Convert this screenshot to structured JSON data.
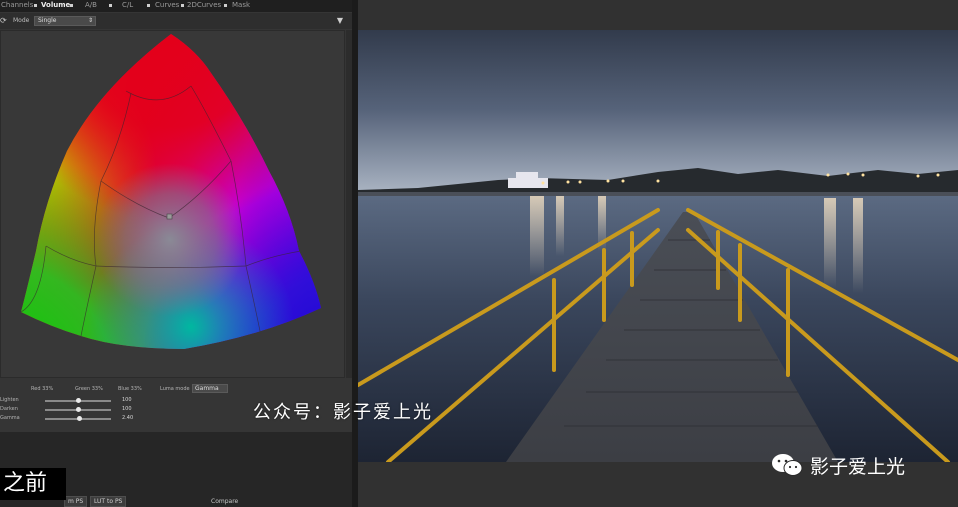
{
  "tabs": [
    {
      "label": "Channels",
      "active": false
    },
    {
      "label": "Volume",
      "active": true
    },
    {
      "label": "A/B",
      "active": false
    },
    {
      "label": "C/L",
      "active": false
    },
    {
      "label": "Curves",
      "active": false
    },
    {
      "label": "2DCurves",
      "active": false
    },
    {
      "label": "Mask",
      "active": false
    }
  ],
  "mode": {
    "label": "Mode",
    "value": "Single"
  },
  "mix": {
    "red": "Red 33%",
    "green": "Green 33%",
    "blue": "Blue 33%",
    "luma_label": "Luma mode",
    "luma_value": "Gamma"
  },
  "sliders": [
    {
      "label": "Lighten",
      "value": "100",
      "level": 0.5
    },
    {
      "label": "Darken",
      "value": "100",
      "level": 0.5
    },
    {
      "label": "Gamma",
      "value": "2.40",
      "level": 0.52
    }
  ],
  "before_label": "之前",
  "buttons": {
    "to_ps": "m PS",
    "lut_to_ps": "LUT to PS"
  },
  "compare_label": "Compare",
  "watermark_center": "公众号：影子爱上光",
  "watermark_right": "影子爱上光",
  "colors": {
    "accent_red": "#e3001a",
    "accent_green": "#00c800",
    "accent_blue": "#1400d0",
    "railing": "#c99a1d"
  }
}
